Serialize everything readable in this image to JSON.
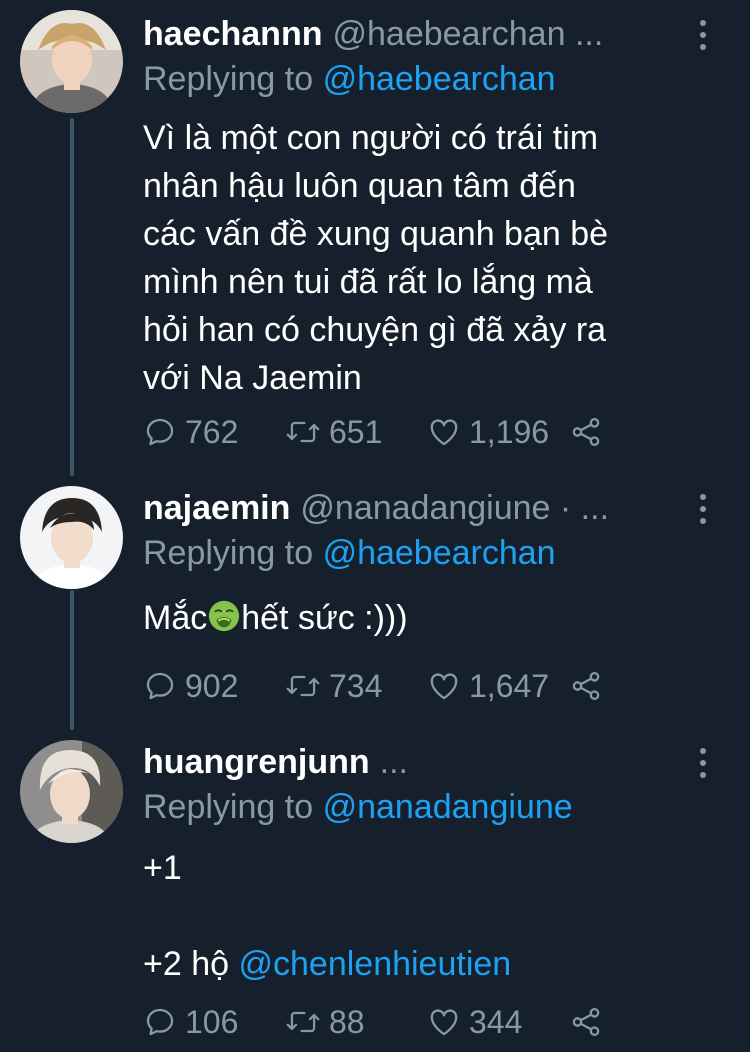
{
  "tweets": [
    {
      "name": "haechannn",
      "handle": "@haebearchan ...",
      "replying_prefix": "Replying to",
      "replying_to": "@haebearchan",
      "body_lines": [
        "Vì là một con người có trái tim",
        "nhân hậu luôn quan tâm đến",
        "các vấn đề xung quanh bạn bè",
        "mình nên tui đã rất lo lắng mà",
        "hỏi han có chuyện gì đã xảy ra",
        "với Na Jaemin"
      ],
      "replies": "762",
      "retweets": "651",
      "likes": "1,196"
    },
    {
      "name": "najaemin",
      "handle": "@nanadangiune · ...",
      "replying_prefix": "Replying to",
      "replying_to": "@haebearchan",
      "body_before_emoji": "Mắc",
      "emoji": "nauseated-face-emoji",
      "body_after_emoji": "hết sức :)))",
      "replies": "902",
      "retweets": "734",
      "likes": "1,647"
    },
    {
      "name": "huangrenjunn",
      "handle": "...",
      "replying_prefix": "Replying to",
      "replying_to": "@nanadangiune",
      "body_line1": "+1",
      "body_line2_prefix": "+2 hộ",
      "body_line2_mention": "@chenlenhieutien",
      "replies": "106",
      "retweets": "88",
      "likes": "344"
    }
  ],
  "icons": {
    "reply": "speech-bubble-icon",
    "retweet": "retweet-icon",
    "like": "heart-icon",
    "share": "share-icon",
    "more": "vertical-ellipsis-icon"
  },
  "colors": {
    "background": "#16202c",
    "accent": "#1da1f2",
    "secondary_text": "#8899a6",
    "thread_line": "#3d5466"
  }
}
